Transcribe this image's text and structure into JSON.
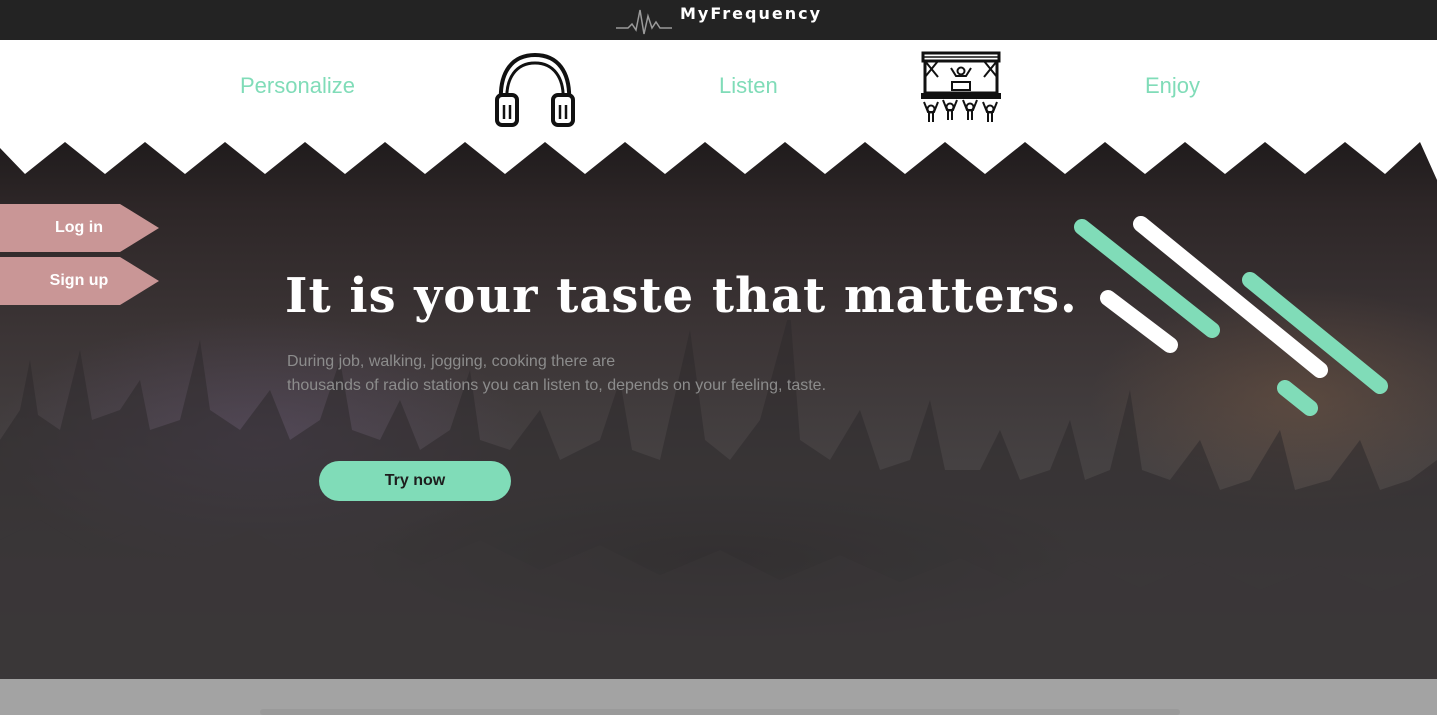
{
  "header": {
    "brand": "MyFrequency",
    "pulse_icon": "pulse-icon"
  },
  "nav": {
    "items": [
      {
        "label": "Personalize"
      },
      {
        "label": "Listen"
      },
      {
        "label": "Enjoy"
      }
    ],
    "icons": [
      "headphones-icon",
      "concert-stage-icon"
    ]
  },
  "sidebar": {
    "login_label": "Log in",
    "signup_label": "Sign up"
  },
  "hero": {
    "headline": "It is your taste that matters.",
    "sub_line1": "During job, walking, jogging, cooking there are",
    "sub_line2": "thousands of radio stations you can listen to, depends on your feeling, taste.",
    "cta_label": "Try now",
    "decor_icon": "diagonal-stripes-icon"
  },
  "colors": {
    "accent": "#80dcb8",
    "ribbon": "#c99696",
    "topbar": "#232323",
    "subtext": "#8c8c8c"
  }
}
